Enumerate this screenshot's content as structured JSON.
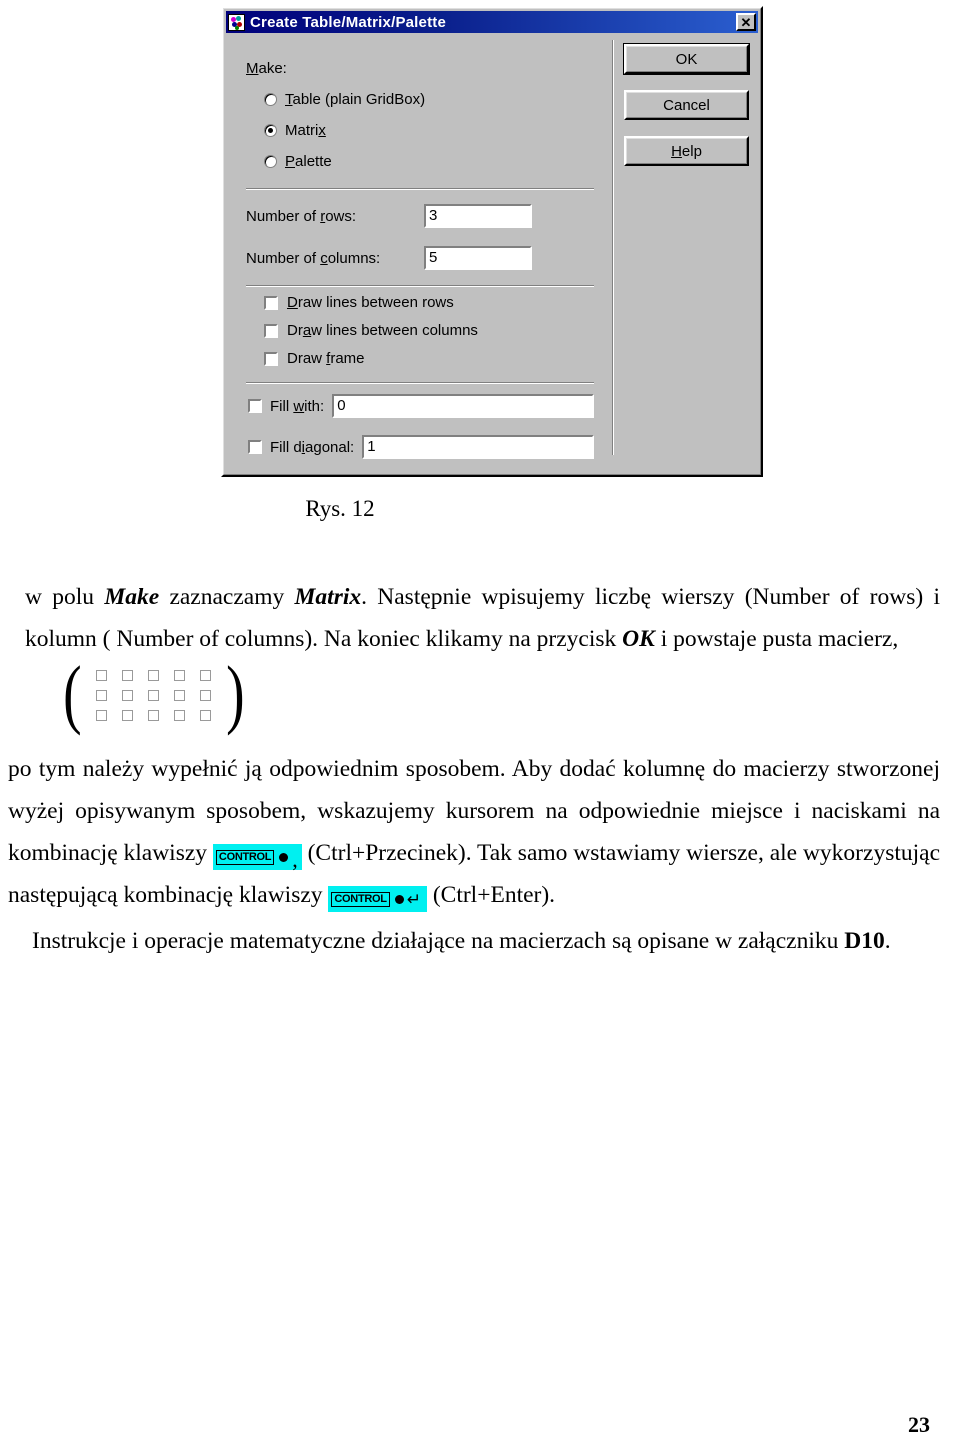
{
  "dialog": {
    "title": "Create Table/Matrix/Palette",
    "title_icon": "palette-icon",
    "close_label": "✕",
    "make_label": "Make:",
    "radios": [
      {
        "label_pre": "",
        "mnemonic": "T",
        "label_post": "able (plain GridBox)",
        "selected": false,
        "name": "table"
      },
      {
        "label_pre": "Matri",
        "mnemonic": "x",
        "label_post": "",
        "selected": true,
        "name": "matrix"
      },
      {
        "label_pre": "",
        "mnemonic": "P",
        "label_post": "alette",
        "selected": false,
        "name": "palette"
      }
    ],
    "fields": [
      {
        "label_pre": "Number of ",
        "mnemonic": "r",
        "label_post": "ows:",
        "value": "3",
        "name": "number-of-rows"
      },
      {
        "label_pre": "Number of ",
        "mnemonic": "c",
        "label_post": "olumns:",
        "value": "5",
        "name": "number-of-columns"
      }
    ],
    "checkboxes": [
      {
        "label_pre": "",
        "mnemonic": "D",
        "label_post": "raw lines between rows",
        "checked": false,
        "name": "draw-lines-between-rows"
      },
      {
        "label_pre": "Dr",
        "mnemonic": "a",
        "label_post": "w lines between columns",
        "checked": false,
        "name": "draw-lines-between-columns"
      },
      {
        "label_pre": "Draw ",
        "mnemonic": "f",
        "label_post": "rame",
        "checked": false,
        "name": "draw-frame"
      }
    ],
    "fills": [
      {
        "label_pre": "Fill ",
        "mnemonic": "w",
        "label_post": "ith:",
        "value": "0",
        "checked": false,
        "name": "fill-with"
      },
      {
        "label_pre": "Fill d",
        "mnemonic": "i",
        "label_post": "agonal:",
        "value": "1",
        "checked": false,
        "name": "fill-diagonal"
      }
    ],
    "buttons": [
      {
        "label_pre": "OK",
        "mnemonic": "",
        "label_post": "",
        "default": true,
        "name": "ok"
      },
      {
        "label_pre": "Cancel",
        "mnemonic": "",
        "label_post": "",
        "default": false,
        "name": "cancel"
      },
      {
        "label_pre": "",
        "mnemonic": "H",
        "label_post": "elp",
        "default": false,
        "name": "help"
      }
    ],
    "colors": {
      "face": "#c0c0c0",
      "titlebar_start": "#00007b",
      "titlebar_end": "#2b5fd0",
      "field_bg": "#ffffff"
    }
  },
  "document": {
    "figure_caption": "Rys. 12",
    "para1": {
      "t1": "w polu ",
      "b1": "Make",
      "t2": " zaznaczamy ",
      "b2": "Matrix",
      "t3": ". Następnie wpisujemy liczbę wierszy (Number of rows) i kolumn ( Number of columns). Na koniec klikamy na przycisk ",
      "b3": "OK",
      "t4": " i powstaje pusta macierz,"
    },
    "matrix_figure": {
      "rows": 3,
      "columns": 5,
      "cell": "placeholder-box",
      "left_paren": "(",
      "right_paren": ")"
    },
    "para2": {
      "t1": "po tym należy wypełnić ją odpowiednim sposobem. Aby dodać kolumnę do macierzy stworzonej wyżej opisywanym sposobem, wskazujemy kursorem na odpowiednie miejsce i naciskami na kombinację klawiszy ",
      "badge1": {
        "key": "CONTROL",
        "dot": "●",
        "after": ","
      },
      "t2": " (Ctrl+Przecinek). Tak samo wstawiamy wiersze, ale wykorzystując następującą kombinację klawiszy ",
      "badge2": {
        "key": "CONTROL",
        "dot": "●",
        "after": "↵"
      },
      "t3": " (Ctrl+Enter)."
    },
    "para3": {
      "t1": "Instrukcje i operacje matematyczne działające na macierzach są opisane w załączniku ",
      "b1": "D10",
      "t2": "."
    },
    "page_number": "23"
  }
}
